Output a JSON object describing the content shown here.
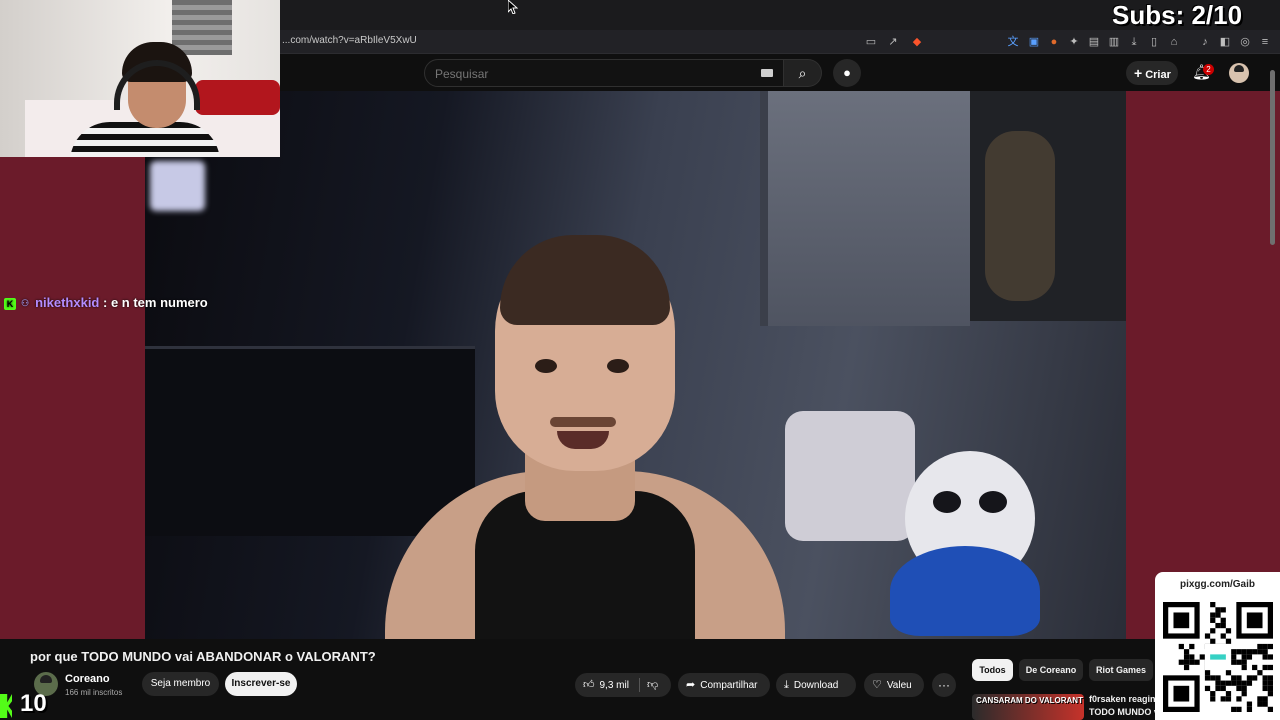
{
  "browser": {
    "url": "...com/watch?v=aRbIleV5XwU"
  },
  "youtube": {
    "search_placeholder": "Pesquisar",
    "create_label": "Criar",
    "notification_count": "2"
  },
  "overlay": {
    "subs_counter": "Subs: 2/10",
    "chat": {
      "username": "nikethxkid",
      "message": ": e n tem numero"
    },
    "viewer_count": "10",
    "qr_url": "pixgg.com/Gaib"
  },
  "video": {
    "title": "por que TODO MUNDO vai ABANDONAR o VALORANT?",
    "channel_name": "Coreano",
    "channel_subs": "166 mil inscritos",
    "join_label": "Seja membro",
    "subscribe_label": "Inscrever-se",
    "like_count": "9,3 mil",
    "share_label": "Compartilhar",
    "download_label": "Download",
    "thanks_label": "Valeu",
    "more_label": "···"
  },
  "chips": [
    "Todos",
    "De Coreano",
    "Riot Games"
  ],
  "recommended": {
    "thumb_text": "CANSARAM DO VALORANT",
    "line1": "f0rsaken reagin",
    "line2": "TODO MUNDO v"
  },
  "colors": {
    "side_background": "#6b1b2a",
    "kick_green": "#53fc18",
    "chat_username": "#b48cff",
    "subscribe_bg": "#f1f1f1",
    "notification_red": "#cc0000"
  },
  "icons": {
    "search": "search-icon",
    "mic": "mic-icon",
    "bell": "bell-icon",
    "like": "thumbs-up-icon",
    "dislike": "thumbs-down-icon",
    "share": "share-icon",
    "download": "download-icon",
    "thanks": "thanks-icon"
  }
}
